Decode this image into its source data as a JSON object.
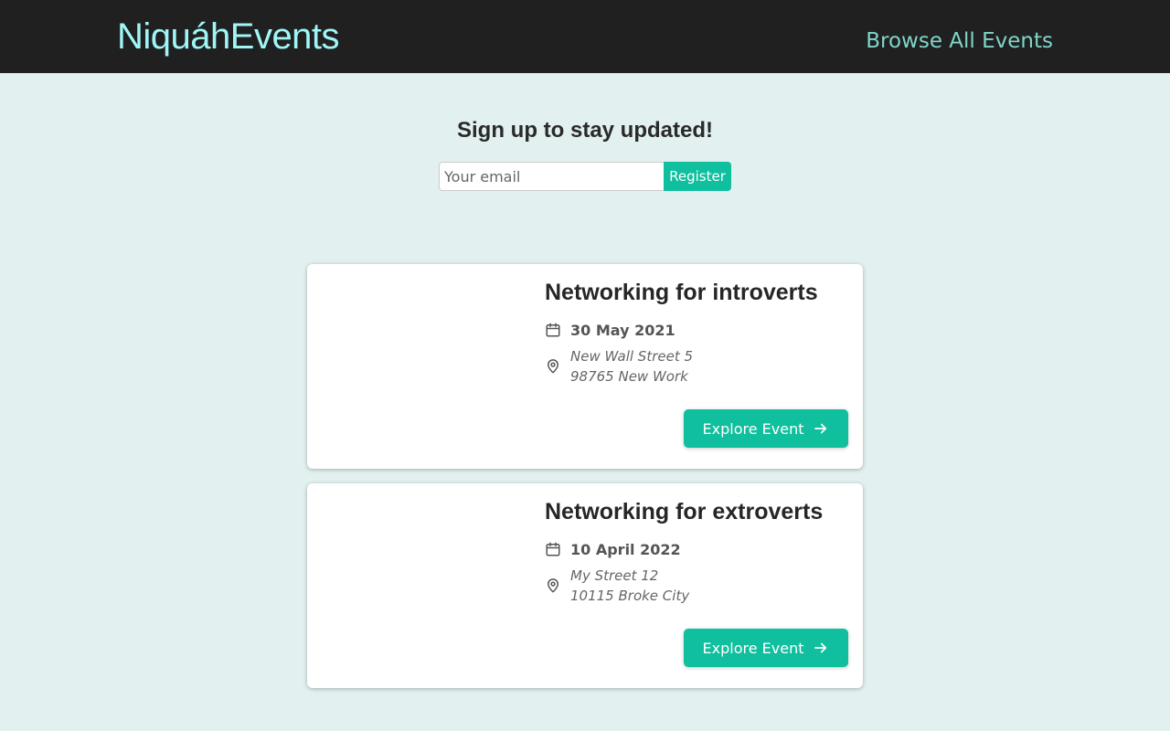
{
  "header": {
    "logo": "NiquáhEvents",
    "nav_link": "Browse All Events"
  },
  "signup": {
    "title": "Sign up to stay updated!",
    "email_placeholder": "Your email",
    "email_value": "",
    "register_label": "Register"
  },
  "events": [
    {
      "title": "Networking for introverts",
      "date": "30 May 2021",
      "address_line1": "New Wall Street 5",
      "address_line2": "98765 New Work",
      "button_label": "Explore Event"
    },
    {
      "title": "Networking for extroverts",
      "date": "10 April 2022",
      "address_line1": "My Street 12",
      "address_line2": "10115 Broke City",
      "button_label": "Explore Event"
    }
  ],
  "icons": {
    "date": "calendar-icon",
    "location": "location-pin-icon",
    "arrow": "arrow-right-icon"
  },
  "colors": {
    "header_bg": "#202020",
    "logo": "#a0f6f6",
    "nav_link": "#7fd6c9",
    "page_bg": "#e2f0f0",
    "accent": "#0fbf9e"
  }
}
